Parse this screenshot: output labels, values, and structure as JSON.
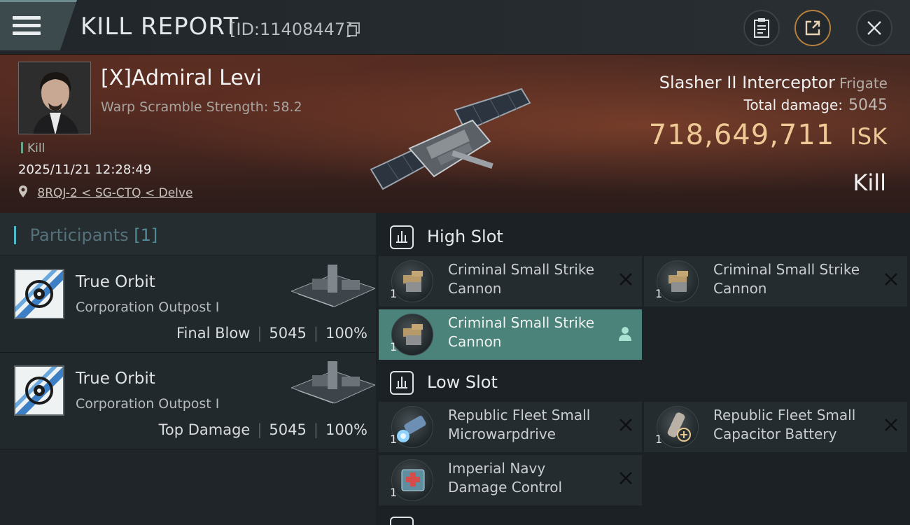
{
  "header": {
    "title": "KILL REPORT",
    "report_id": "[ID:11408447]"
  },
  "icons": {
    "menu": "hamburger-menu-icon",
    "copy": "copy-icon",
    "clipboard": "clipboard-icon",
    "export": "export-icon",
    "close": "close-icon"
  },
  "victim": {
    "name": "[X]Admiral Levi",
    "warp_scramble": "Warp Scramble Strength: 58.2",
    "tag": "Kill",
    "datetime": "2025/11/21 12:28:49",
    "location": "8RQJ-2 < SG-CTQ < Delve"
  },
  "ship": {
    "name": "Slasher II Interceptor",
    "class": "Frigate",
    "total_damage_label": "Total damage:",
    "total_damage": "5045",
    "isk_value": "718,649,711",
    "isk_unit": "ISK",
    "outcome": "Kill"
  },
  "participants": {
    "title": "Participants",
    "count": "[1]",
    "rows": [
      {
        "name": "True Orbit",
        "type": "Corporation Outpost I",
        "label": "Final Blow",
        "damage": "5045",
        "percent": "100%"
      },
      {
        "name": "True Orbit",
        "type": "Corporation Outpost I",
        "label": "Top Damage",
        "damage": "5045",
        "percent": "100%"
      }
    ]
  },
  "slots": {
    "high": {
      "title": "High Slot",
      "modules": [
        {
          "name_line1": "Criminal Small Strike",
          "name_line2": "Cannon",
          "qty": "1"
        },
        {
          "name_line1": "Criminal Small Strike",
          "name_line2": "Cannon",
          "qty": "1"
        },
        {
          "name_line1": "Criminal Small Strike",
          "name_line2": "Cannon",
          "qty": "1"
        }
      ]
    },
    "low": {
      "title": "Low Slot",
      "modules": [
        {
          "name_line1": "Republic Fleet Small",
          "name_line2": "Microwarpdrive",
          "qty": "1"
        },
        {
          "name_line1": "Republic Fleet Small",
          "name_line2": "Capacitor Battery",
          "qty": "1"
        },
        {
          "name_line1": "Imperial Navy",
          "name_line2": "Damage Control",
          "qty": "1"
        }
      ]
    }
  },
  "colors": {
    "isk": "#efc995",
    "active_module": "#4b8279",
    "accent_teal": "#4db8c9"
  }
}
